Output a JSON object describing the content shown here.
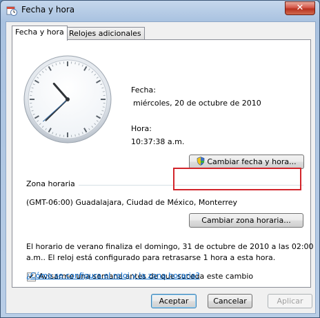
{
  "window": {
    "title": "Fecha y hora",
    "close_glyph": "✕"
  },
  "tabs": [
    {
      "label": "Fecha y hora",
      "active": true
    },
    {
      "label": "Relojes adicionales",
      "active": false
    }
  ],
  "datetime": {
    "date_label": "Fecha:",
    "date_value": "miércoles, 20 de octubre de 2010",
    "time_label": "Hora:",
    "time_value": "10:37:38 a.m.",
    "change_button": "Cambiar fecha y hora...",
    "clock": {
      "hour": 10,
      "minute": 37,
      "second": 38
    }
  },
  "timezone": {
    "section_label": "Zona horaria",
    "value": "(GMT-06:00) Guadalajara, Ciudad de México, Monterrey",
    "change_button": "Cambiar zona horaria..."
  },
  "dst_message": {
    "line1": "El horario de verano finaliza el domingo, 31 de octubre de 2010 a las 02:00",
    "line2": "a.m.. El reloj está configurado para retrasarse 1 hora a esta hora."
  },
  "notify_checkbox": {
    "label": "Avisarme una semana antes de que suceda este cambio",
    "checked": true
  },
  "help_link": "¿Cómo se configura el reloj y la zona horaria?",
  "footer": {
    "ok": "Aceptar",
    "cancel": "Cancelar",
    "apply": "Aplicar"
  },
  "colors": {
    "highlight": "#d2242a",
    "link": "#0066cc"
  }
}
